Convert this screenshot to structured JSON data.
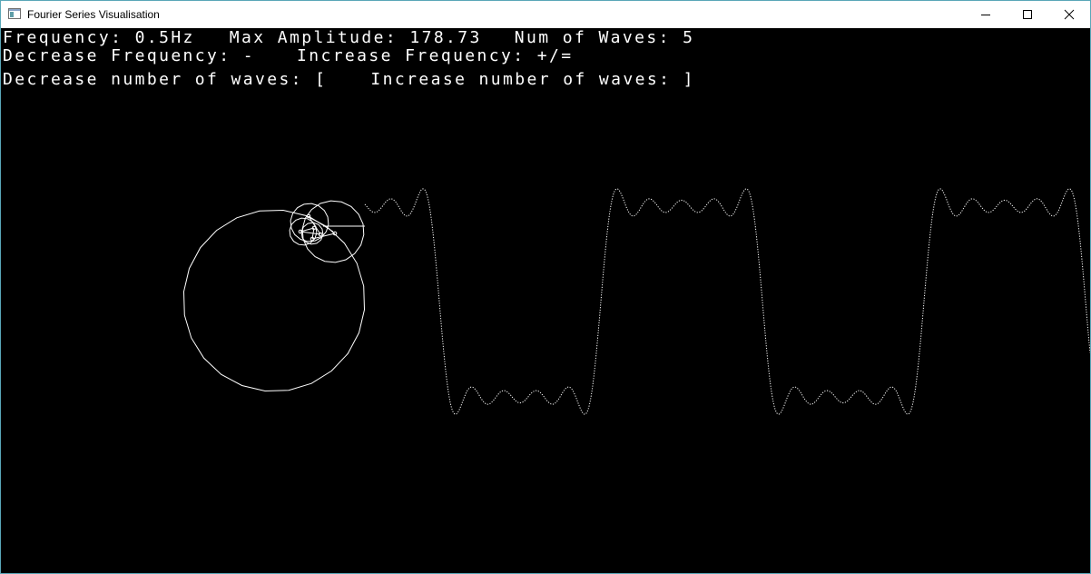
{
  "window": {
    "title": "Fourier Series Visualisation",
    "icon": "app-window-icon",
    "controls": [
      "minimize-icon",
      "maximize-icon",
      "close-icon"
    ]
  },
  "hud": {
    "frequency": "Frequency: 0.5Hz",
    "max_amplitude": "Max Amplitude: 178.73",
    "num_waves": "Num of Waves: 5",
    "decrease_frequency": "Decrease Frequency: -",
    "increase_frequency": "Increase Frequency: +/=",
    "decrease_waves": "Decrease number of waves: [",
    "increase_waves": "Increase number of waves: ]"
  },
  "visualisation": {
    "frequency_hz": 0.5,
    "max_amplitude": 178.73,
    "num_waves": 5,
    "waveform": "square-wave",
    "colors": {
      "background": "#000000",
      "foreground": "#ffffff"
    }
  }
}
